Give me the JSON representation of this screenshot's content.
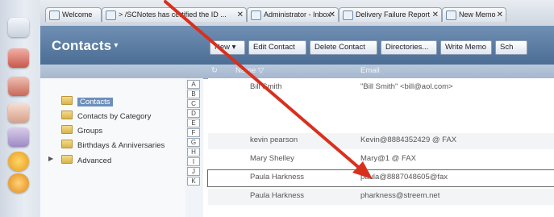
{
  "launcher": {
    "icons": [
      "mail-icon",
      "calendar-icon",
      "contacts-icon",
      "todo-icon",
      "notebook-icon",
      "smiley-icon",
      "sametime-icon"
    ]
  },
  "tabs": [
    {
      "label": "Welcome"
    },
    {
      "label": "> /SCNotes has certified the ID ..."
    },
    {
      "label": "Administrator - Inbox"
    },
    {
      "label": "Delivery Failure Report"
    },
    {
      "label": "New Memo"
    }
  ],
  "view": {
    "title": "Contacts",
    "title_caret": "▾"
  },
  "actions": [
    {
      "label": "New ▾"
    },
    {
      "label": "Edit Contact"
    },
    {
      "label": "Delete Contact"
    },
    {
      "label": "Directories..."
    },
    {
      "label": "Write Memo"
    },
    {
      "label": "Sch"
    }
  ],
  "table": {
    "columns": [
      {
        "label": "Name ▽"
      },
      {
        "label": "Email"
      }
    ],
    "rows": [
      {
        "name": "Bill Smith",
        "email": "\"Bill Smith\" <bill@aol.com>"
      },
      {
        "name": "",
        "email": ""
      },
      {
        "name": "",
        "email": ""
      },
      {
        "name": "kevin pearson",
        "email": "Kevin@8884352429 @ FAX"
      },
      {
        "name": "Mary Shelley",
        "email": "Mary@1 @ FAX"
      },
      {
        "name": "Paula Harkness",
        "email": "paula@8887048605@fax"
      },
      {
        "name": "Paula Harkness",
        "email": "pharkness@streem.net"
      }
    ]
  },
  "navigator": {
    "items": [
      {
        "label": "Contacts",
        "selected": true
      },
      {
        "label": "Contacts by Category"
      },
      {
        "label": "Groups"
      },
      {
        "label": "Birthdays & Anniversaries"
      },
      {
        "label": "Advanced",
        "twisty": "▶"
      }
    ]
  },
  "alphabet": [
    "A",
    "B",
    "C",
    "D",
    "E",
    "F",
    "G",
    "H",
    "I",
    "J",
    "K"
  ],
  "colors": {
    "header_blue": "#4c6d94",
    "selection_blue": "#6d8fbc",
    "arrow_red": "#d9301e"
  }
}
